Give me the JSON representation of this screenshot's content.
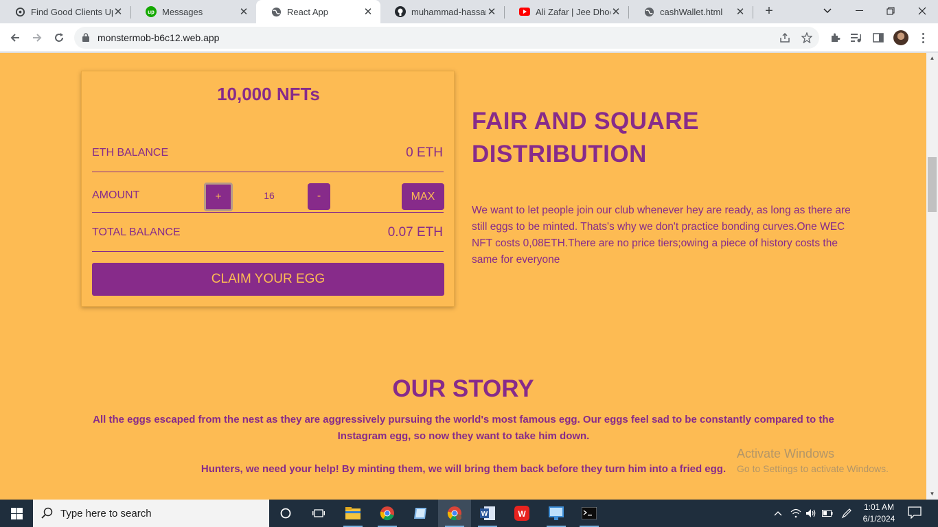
{
  "browser": {
    "tabs": [
      {
        "title": "Find Good Clients Upwork",
        "icon": "openai-icon",
        "active": false
      },
      {
        "title": "Messages",
        "icon": "upwork-icon",
        "active": false
      },
      {
        "title": "React App",
        "icon": "globe-icon",
        "active": true
      },
      {
        "title": "muhammad-hassan-nadeem",
        "icon": "github-icon",
        "active": false
      },
      {
        "title": "Ali Zafar | Jee Dhoondta",
        "icon": "youtube-icon",
        "active": false
      },
      {
        "title": "cashWallet.html",
        "icon": "globe-icon",
        "active": false
      }
    ],
    "url": "monstermob-b6c12.web.app"
  },
  "mint_card": {
    "title": "10,000 NFTs",
    "eth_balance_label": "ETH BALANCE",
    "eth_balance_value": "0 ETH",
    "amount_label": "AMOUNT",
    "plus_label": "+",
    "amount_value": "16",
    "minus_label": "-",
    "max_label": "MAX",
    "total_balance_label": "TOTAL BALANCE",
    "total_balance_value": "0.07 ETH",
    "claim_label": "CLAIM YOUR EGG"
  },
  "fair": {
    "title": "FAIR AND SQUARE DISTRIBUTION",
    "text": "We want to let people join our club whenever hey are ready, as long as there are still eggs to be minted. Thats's why we don't practice bonding curves.One WEC NFT costs 0,08ETH.There are no price tiers;owing a piece of history costs the same for everyone"
  },
  "story": {
    "title": "OUR STORY",
    "p1": "All the eggs escaped from the nest as they are aggressively pursuing the world's most famous egg. Our eggs feel sad to be constantly compared to the Instagram egg, so now they want to take him down.",
    "p2": "Hunters, we need your help! By minting them, we will bring them back before they turn him into a fried egg."
  },
  "watermark": {
    "line1": "Activate Windows",
    "line2": "Go to Settings to activate Windows."
  },
  "taskbar": {
    "search_placeholder": "Type here to search",
    "time": "1:01 AM",
    "date": "6/1/2024"
  },
  "colors": {
    "page_bg": "#fdbb53",
    "brand_purple": "#872b8a"
  }
}
